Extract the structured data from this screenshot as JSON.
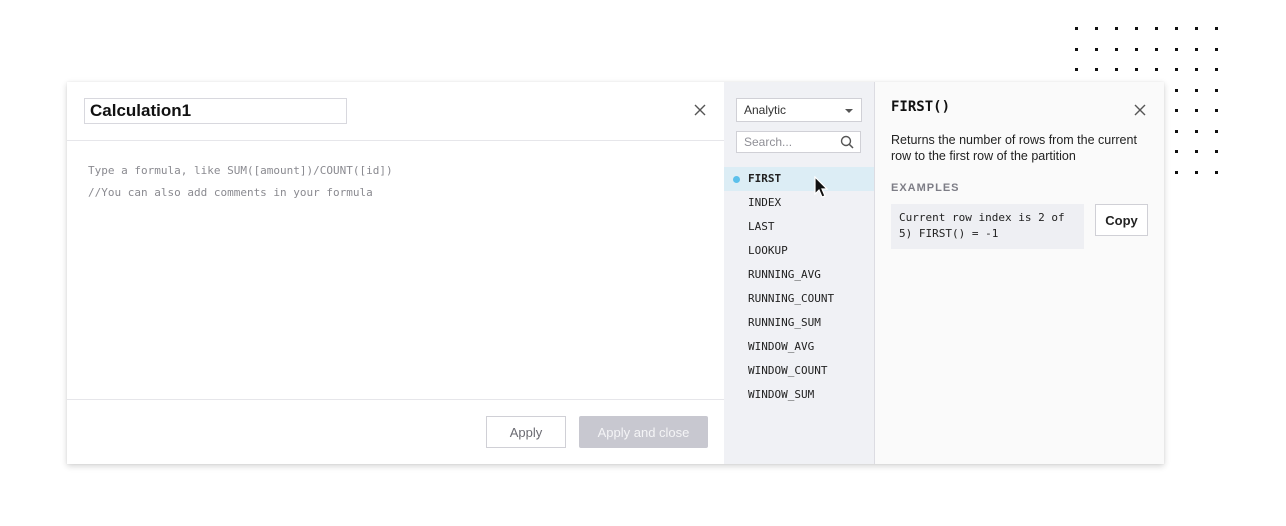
{
  "editor": {
    "calculation_name": "Calculation1",
    "formula_placeholder_lines": [
      "Type a formula, like SUM([amount])/COUNT([id])",
      "//You can also add comments in your formula"
    ],
    "close_icon": "close-icon",
    "apply_label": "Apply",
    "apply_close_label": "Apply and close"
  },
  "functions": {
    "category": "Analytic",
    "search_placeholder": "Search...",
    "search_icon": "search-icon",
    "items": [
      {
        "label": "FIRST",
        "active": true
      },
      {
        "label": "INDEX",
        "active": false
      },
      {
        "label": "LAST",
        "active": false
      },
      {
        "label": "LOOKUP",
        "active": false
      },
      {
        "label": "RUNNING_AVG",
        "active": false
      },
      {
        "label": "RUNNING_COUNT",
        "active": false
      },
      {
        "label": "RUNNING_SUM",
        "active": false
      },
      {
        "label": "WINDOW_AVG",
        "active": false
      },
      {
        "label": "WINDOW_COUNT",
        "active": false
      },
      {
        "label": "WINDOW_SUM",
        "active": false
      }
    ],
    "active_color": "#5bc0eb"
  },
  "doc": {
    "title": "FIRST()",
    "description": "Returns the number of rows from the current row to the first row of the partition",
    "examples_label": "EXAMPLES",
    "example_lines": [
      "Current row index is 2 of",
      "5) FIRST() = -1"
    ],
    "copy_label": "Copy"
  }
}
